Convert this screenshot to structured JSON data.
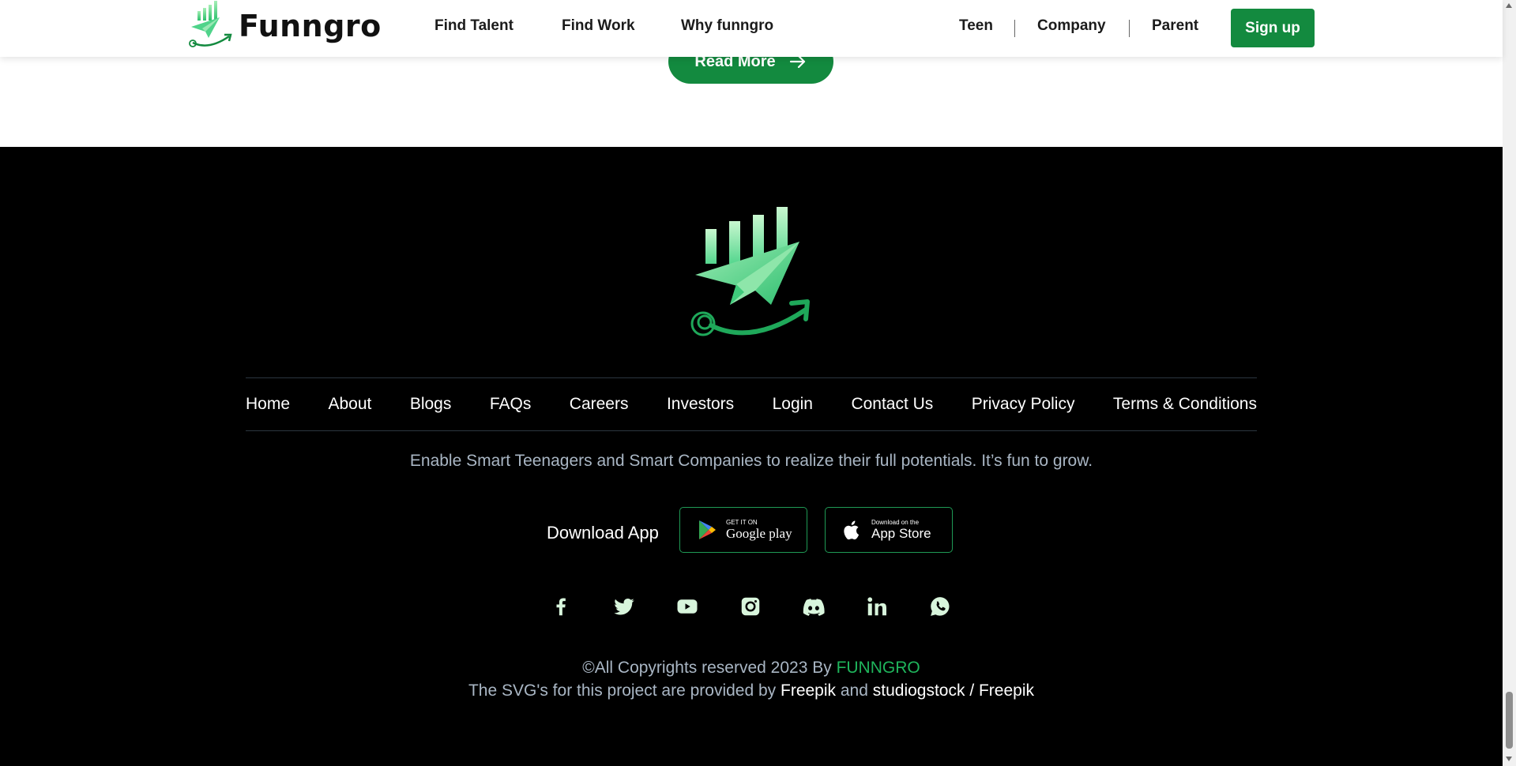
{
  "header": {
    "brand": "Funngro",
    "nav_left": [
      "Find Talent",
      "Find Work",
      "Why funngro"
    ],
    "nav_right": [
      "Teen",
      "Company",
      "Parent"
    ],
    "signup_label": "Sign up"
  },
  "main": {
    "read_more_label": "Read More"
  },
  "footer": {
    "nav": [
      "Home",
      "About",
      "Blogs",
      "FAQs",
      "Careers",
      "Investors",
      "Login",
      "Contact Us",
      "Privacy Policy",
      "Terms & Conditions"
    ],
    "tagline": "Enable Smart Teenagers and Smart Companies to realize their full potentials. It’s fun to grow.",
    "download_label": "Download App",
    "google_play": {
      "small": "GET IT ON",
      "big": "Google play"
    },
    "app_store": {
      "small": "Download on the",
      "big": "App Store"
    },
    "social_icons": [
      "facebook-icon",
      "twitter-icon",
      "youtube-icon",
      "instagram-icon",
      "discord-icon",
      "linkedin-icon",
      "whatsapp-icon"
    ],
    "copyright_prefix": "©All Copyrights reserved 2023 By ",
    "copyright_brand": "FUNNGRO",
    "credits_prefix": "The SVG's for this project are provided by ",
    "credits_link1": "Freepik",
    "credits_and": " and ",
    "credits_link2": "studiogstock / Freepik"
  },
  "colors": {
    "brand_green": "#138a3f",
    "accent_green": "#1fb55c",
    "footer_bg": "#000000",
    "muted_text": "#a9b6c4"
  }
}
